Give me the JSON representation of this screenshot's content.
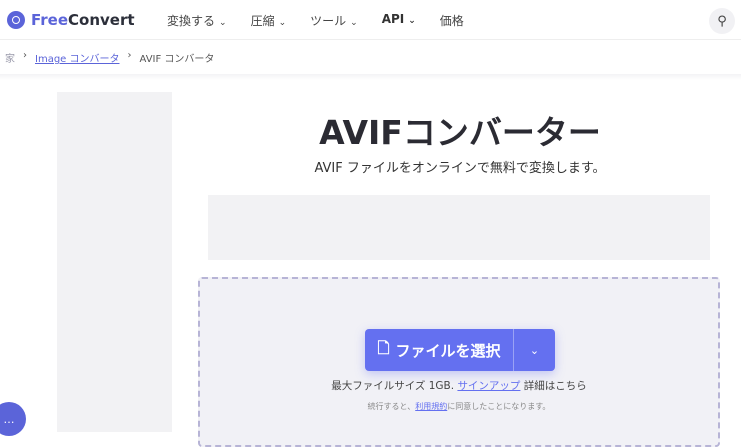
{
  "header": {
    "logo_free": "Free",
    "logo_convert": "Convert",
    "nav": [
      "変換する",
      "圧縮",
      "ツール",
      "API",
      "価格"
    ]
  },
  "breadcrumb": {
    "home": "家",
    "link": "Image コンバータ",
    "current": "AVIF コンバータ"
  },
  "main": {
    "title": "AVIFコンバーター",
    "subtitle": "AVIF ファイルをオンラインで無料で変換します。"
  },
  "upload": {
    "button": "ファイルを選択",
    "max_size": "最大ファイルサイズ 1GB.",
    "signup": "サインアップ",
    "details": "詳細はこちら",
    "terms_pre": "続行すると、",
    "terms_link": "利用規約",
    "terms_post": "に同意したことになります。"
  }
}
